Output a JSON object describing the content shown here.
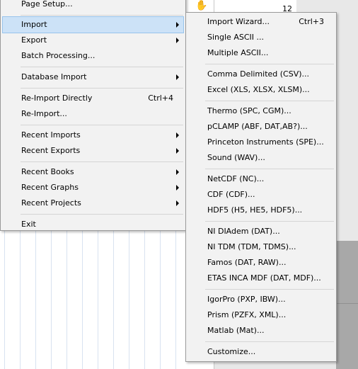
{
  "background": {
    "cell_value": "12",
    "cursor_icon": "hand-pointer-icon"
  },
  "main_menu": {
    "page_setup": "Page Setup...",
    "import": "Import",
    "export": "Export",
    "batch_processing": "Batch Processing...",
    "database_import": "Database Import",
    "reimport_directly": "Re-Import Directly",
    "reimport_directly_shortcut": "Ctrl+4",
    "reimport": "Re-Import...",
    "recent_imports": "Recent Imports",
    "recent_exports": "Recent Exports",
    "recent_books": "Recent Books",
    "recent_graphs": "Recent Graphs",
    "recent_projects": "Recent Projects",
    "exit": "Exit"
  },
  "import_submenu": {
    "import_wizard": "Import Wizard...",
    "import_wizard_shortcut": "Ctrl+3",
    "single_ascii": "Single ASCII ...",
    "multiple_ascii": "Multiple ASCII...",
    "csv": "Comma Delimited (CSV)...",
    "excel": "Excel (XLS, XLSX, XLSM)...",
    "thermo": "Thermo (SPC, CGM)...",
    "pclamp": "pCLAMP (ABF, DAT,AB?)...",
    "princeton": "Princeton Instruments (SPE)...",
    "sound": "Sound (WAV)...",
    "netcdf": "NetCDF (NC)...",
    "cdf": "CDF (CDF)...",
    "hdf5": "HDF5 (H5, HE5, HDF5)...",
    "ni_diadem": "NI DIAdem (DAT)...",
    "ni_tdm": "NI TDM (TDM, TDMS)...",
    "famos": "Famos (DAT, RAW)...",
    "etas": "ETAS INCA MDF (DAT, MDF)...",
    "igorpro": "IgorPro (PXP, IBW)...",
    "prism": "Prism (PZFX, XML)...",
    "matlab": "Matlab (Mat)...",
    "customize": "Customize..."
  },
  "colors": {
    "highlight": "#cce2f7",
    "menu_bg": "#f2f2f2"
  }
}
